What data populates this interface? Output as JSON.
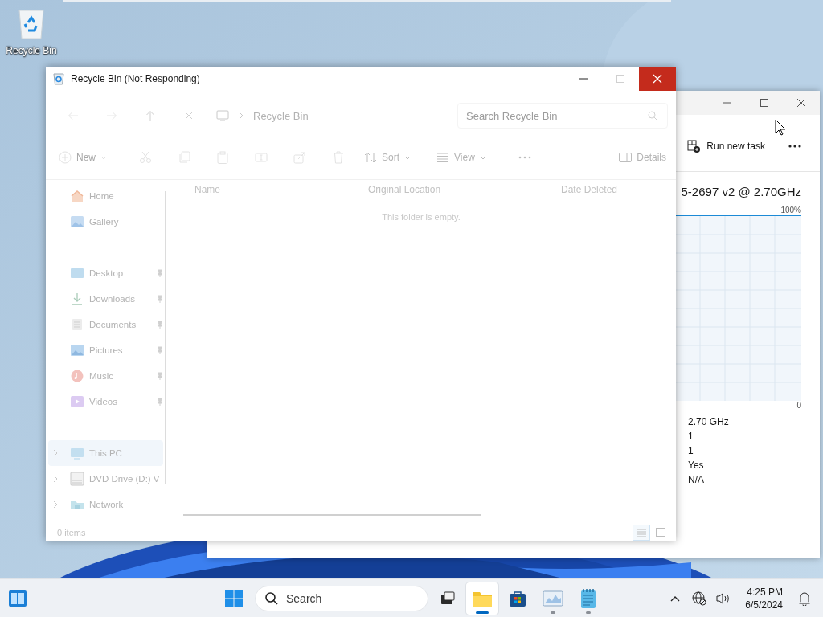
{
  "desktop_icons": [
    {
      "label": "Recycle Bin"
    }
  ],
  "task_manager": {
    "run_new_task": "Run new task",
    "cpu_name": "5-2697 v2 @ 2.70GHz",
    "graph_max": "100%",
    "graph_min": "0",
    "stats": [
      "2.70 GHz",
      "1",
      "1",
      "Yes",
      "N/A"
    ]
  },
  "explorer": {
    "title": "Recycle Bin (Not Responding)",
    "address": "Recycle Bin",
    "search": {
      "placeholder": "Search Recycle Bin"
    },
    "nav": [
      {
        "kind": "back"
      },
      {
        "kind": "forward"
      },
      {
        "kind": "up"
      },
      {
        "kind": "stop"
      }
    ],
    "commands": [
      {
        "kind": "new",
        "label": "New",
        "disabled": true
      },
      {
        "kind": "cut",
        "disabled": true
      },
      {
        "kind": "copy",
        "disabled": true
      },
      {
        "kind": "paste",
        "disabled": true
      },
      {
        "kind": "rename",
        "disabled": true
      },
      {
        "kind": "share",
        "disabled": true
      },
      {
        "kind": "delete",
        "disabled": true
      },
      {
        "kind": "sort",
        "label": "Sort",
        "disabled": false
      },
      {
        "kind": "view",
        "label": "View",
        "disabled": false
      },
      {
        "kind": "more",
        "disabled": false
      }
    ],
    "details_button": "Details",
    "sidebar": [
      {
        "items": [
          {
            "kind": "home",
            "label": "Home",
            "selected": false
          },
          {
            "kind": "gallery",
            "label": "Gallery",
            "selected": false
          }
        ]
      },
      {
        "items": [
          {
            "kind": "desktop",
            "label": "Desktop",
            "pinned": true,
            "selected": false
          },
          {
            "kind": "downloads",
            "label": "Downloads",
            "pinned": true,
            "selected": false
          },
          {
            "kind": "documents",
            "label": "Documents",
            "pinned": true,
            "selected": false
          },
          {
            "kind": "pictures",
            "label": "Pictures",
            "pinned": true,
            "selected": false
          },
          {
            "kind": "music",
            "label": "Music",
            "pinned": true,
            "selected": false
          },
          {
            "kind": "videos",
            "label": "Videos",
            "pinned": true,
            "selected": false
          }
        ]
      },
      {
        "items": [
          {
            "kind": "pc",
            "label": "This PC",
            "expandable": true,
            "selected": true
          },
          {
            "kind": "dvd",
            "label": "DVD Drive (D:) V",
            "expandable": true,
            "selected": false
          },
          {
            "kind": "network",
            "label": "Network",
            "expandable": true,
            "selected": false
          }
        ]
      }
    ],
    "columns": [
      "Name",
      "Original Location",
      "Date Deleted"
    ],
    "empty_message": "This folder is empty.",
    "status": "0 items",
    "view_buttons": [
      {
        "kind": "details",
        "selected": true
      },
      {
        "kind": "tiles",
        "selected": false
      }
    ]
  },
  "taskbar": {
    "search": {
      "placeholder": "Search"
    },
    "apps": [
      {
        "kind": "task-view",
        "running": false,
        "active": false
      },
      {
        "kind": "explorer",
        "running": true,
        "active": true
      },
      {
        "kind": "store",
        "running": false,
        "active": false
      },
      {
        "kind": "task-manager",
        "running": true,
        "active": false
      },
      {
        "kind": "notepad",
        "running": true,
        "active": false
      }
    ],
    "time": "4:25 PM",
    "date": "6/5/2024"
  }
}
